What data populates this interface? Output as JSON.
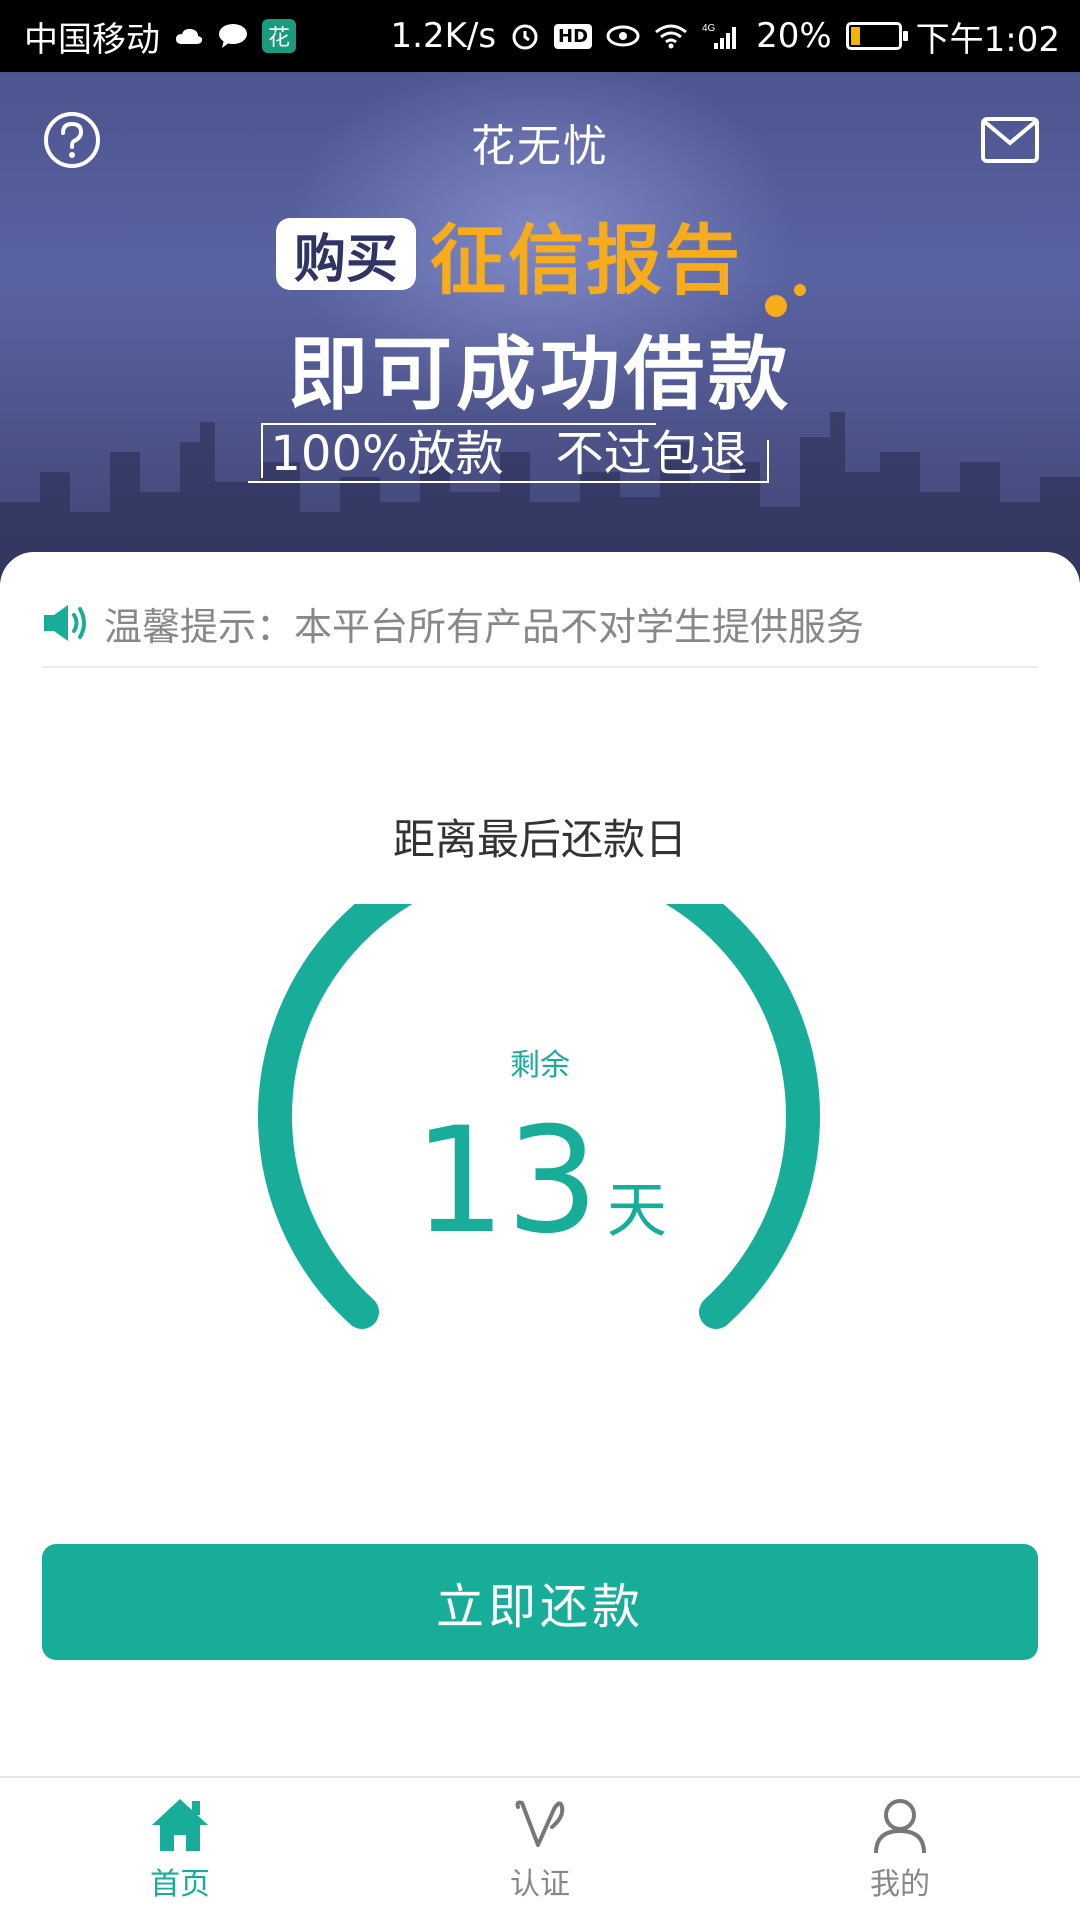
{
  "status_bar": {
    "carrier": "中国移动",
    "speed": "1.2K/s",
    "hd": "HD",
    "network": "4G",
    "battery": "20%",
    "battery_level": 0.2,
    "time": "下午1:02",
    "app_badge": "花"
  },
  "header": {
    "title": "花无忧"
  },
  "banner": {
    "tag": "购买",
    "highlight": "征信报告",
    "line2": "即可成功借款",
    "line3_left": "100%放款",
    "line3_right": "不过包退"
  },
  "notice": {
    "text": "温馨提示：本平台所有产品不对学生提供服务"
  },
  "countdown": {
    "title": "距离最后还款日",
    "remaining_label": "剩余",
    "days": "13",
    "unit": "天"
  },
  "repay_button": {
    "label": "立即还款"
  },
  "tabs": [
    {
      "label": "首页",
      "icon": "home-icon",
      "active": true
    },
    {
      "label": "认证",
      "icon": "verify-icon",
      "active": false
    },
    {
      "label": "我的",
      "icon": "profile-icon",
      "active": false
    }
  ],
  "colors": {
    "accent": "#17ad98",
    "highlight": "#f7ad1b",
    "banner": "#535b98"
  }
}
